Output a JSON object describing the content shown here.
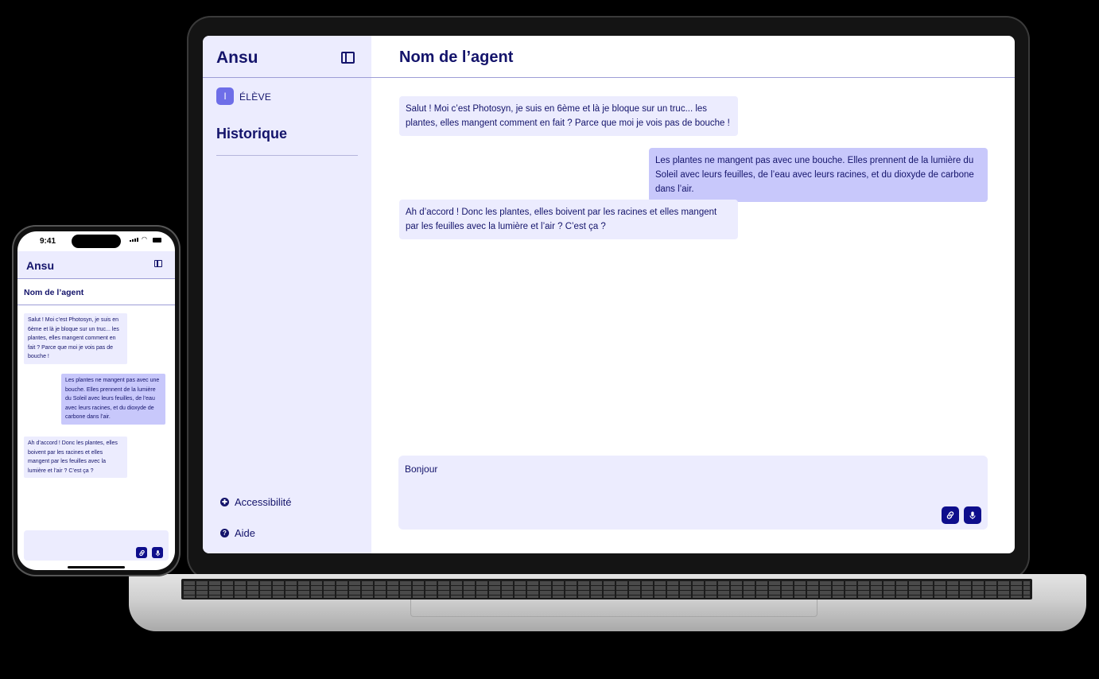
{
  "desktop": {
    "sidebar": {
      "brand": "Ansu",
      "role_initial": "I",
      "role_label": "ÉLÈVE",
      "history_title": "Historique",
      "footer": [
        {
          "label": "Accessibilité",
          "icon": "accessibility-icon"
        },
        {
          "label": "Aide",
          "icon": "help-icon"
        }
      ]
    },
    "main": {
      "title": "Nom de l’agent",
      "messages": [
        {
          "role": "agent",
          "text": "Salut ! Moi c’est Photosyn, je suis en 6ème et là je bloque sur un truc... les plantes, elles mangent comment en fait ? Parce que moi je vois pas de bouche !"
        },
        {
          "role": "user",
          "text": "Les plantes ne mangent pas avec une bouche. Elles prennent de la lumière du Soleil avec leurs feuilles, de l’eau avec leurs racines, et du dioxyde de carbone dans l’air."
        },
        {
          "role": "agent",
          "text": "Ah d’accord ! Donc les plantes, elles boivent par les racines et elles mangent par les feuilles avec la lumière et l’air ? C’est ça ?"
        }
      ],
      "composer": {
        "value": "Bonjour",
        "attach_icon": "link-icon",
        "mic_icon": "microphone-icon"
      }
    }
  },
  "mobile": {
    "status_time": "9:41",
    "brand": "Ansu",
    "title": "Nom de l’agent",
    "messages": [
      {
        "role": "agent",
        "text": "Salut ! Moi c’est Photosyn, je suis en 6ème et là je bloque sur un truc... les plantes, elles mangent comment en fait ? Parce que moi je vois pas de bouche !"
      },
      {
        "role": "user",
        "text": "Les plantes ne mangent pas avec une bouche. Elles prennent de la lumière du Soleil avec leurs feuilles, de l’eau avec leurs racines, et du dioxyde de carbone dans l’air."
      },
      {
        "role": "agent",
        "text": "Ah d’accord ! Donc les plantes, elles boivent par les racines et elles mangent par les feuilles avec la lumière et l’air ? C’est ça ?"
      }
    ]
  },
  "colors": {
    "brand_navy": "#14146b",
    "sidebar_bg": "#ececfe",
    "user_bubble": "#c8c8fb",
    "button": "#0e0e8c"
  }
}
